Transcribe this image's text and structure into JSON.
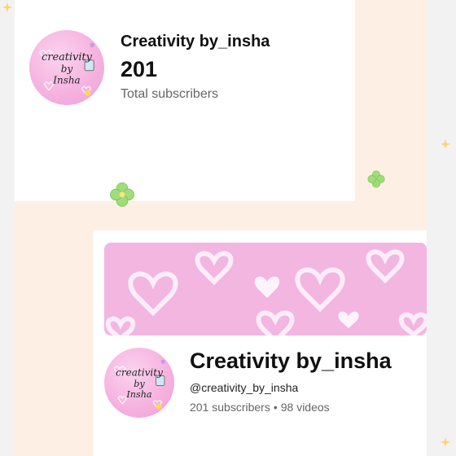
{
  "top_card": {
    "channel_name": "Creativity by_insha",
    "subscriber_count": "201",
    "subscriber_label": "Total subscribers"
  },
  "bottom_card": {
    "channel_name": "Creativity by_insha",
    "handle": "@creativity_by_insha",
    "subscribers": "201 subscribers",
    "separator": "•",
    "videos": "98 videos"
  },
  "avatar": {
    "line1": "creativity",
    "line2": "by",
    "line3": "Insha"
  },
  "colors": {
    "collage_background": "#fdefe3",
    "avatar_pink": "#f6b3e0",
    "banner_pink": "#f2b6e1",
    "clover_green": "#9fdc7a"
  }
}
